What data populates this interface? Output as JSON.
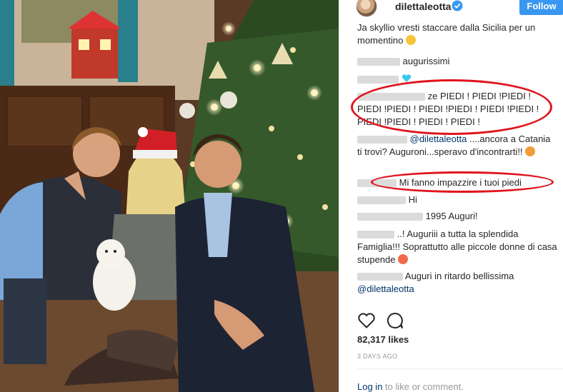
{
  "header": {
    "username": "dilettaleotta",
    "follow_label": "Follow"
  },
  "comments": [
    {
      "user": "",
      "text": "Ja skyllio vresti staccare dalla Sicilia per un momentino"
    },
    {
      "user": "",
      "text": "augurissimi"
    },
    {
      "user": "",
      "text": ""
    },
    {
      "user": "",
      "text": "ze PIEDI ! PIEDI !PIEDI ! PIEDI !PIEDI ! PIEDI !PIEDI ! PIEDI !PIEDI ! PIEDI !PIEDI ! PIEDI ! PIEDI !"
    },
    {
      "user": "",
      "mention": "@dilettaleotta",
      "text": "....ancora a Catania ti trovi? Auguroni...speravo d'incontrarti!!"
    },
    {
      "user": "",
      "text": "Mi fanno impazzire i tuoi piedi"
    },
    {
      "user": "",
      "text": "Hi"
    },
    {
      "user": "",
      "text": "1995 Auguri!"
    },
    {
      "user": "",
      "text": "..! Auguriii a tutta la splendida Famiglia!!! Soprattutto alle piccole donne di casa stupende"
    },
    {
      "user": "",
      "text": "Auguri in ritardo bellissima",
      "mention": "@dilettaleotta"
    }
  ],
  "stats": {
    "likes": "82,317 likes",
    "time_ago": "3 DAYS AGO"
  },
  "footer": {
    "login_link": "Log in",
    "login_text": "to like or comment."
  },
  "colors": {
    "accent": "#3897f0",
    "annotation": "#e0141d",
    "mention": "#003569"
  }
}
